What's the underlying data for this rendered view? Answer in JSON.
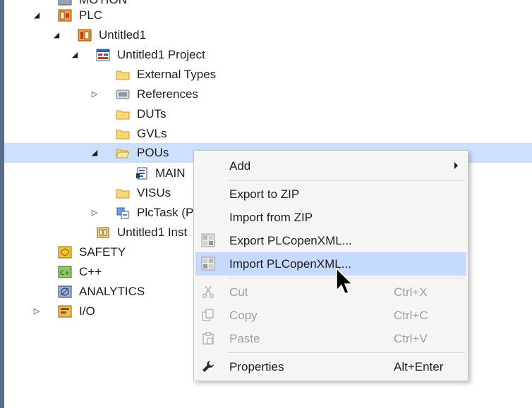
{
  "tree": {
    "motion_label": "MOTION",
    "plc_label": "PLC",
    "untitled1_label": "Untitled1",
    "project_label": "Untitled1 Project",
    "external_types_label": "External Types",
    "references_label": "References",
    "duts_label": "DUTs",
    "gvls_label": "GVLs",
    "pous_label": "POUs",
    "main_label": "MAIN",
    "visus_label": "VISUs",
    "plctask_label": "PlcTask (Pl",
    "instance_label": "Untitled1 Inst",
    "safety_label": "SAFETY",
    "cpp_label": "C++",
    "analytics_label": "ANALYTICS",
    "io_label": "I/O"
  },
  "context_menu": {
    "add": "Add",
    "export_zip": "Export to ZIP",
    "import_zip": "Import from ZIP",
    "export_plcopen": "Export PLCopenXML...",
    "import_plcopen": "Import PLCopenXML...",
    "cut": "Cut",
    "cut_shortcut": "Ctrl+X",
    "copy": "Copy",
    "copy_shortcut": "Ctrl+C",
    "paste": "Paste",
    "paste_shortcut": "Ctrl+V",
    "properties": "Properties",
    "properties_shortcut": "Alt+Enter"
  },
  "colors": {
    "selection": "#cce0ff",
    "menu_highlight": "#c6d9ff",
    "menu_background": "#f5f5f5",
    "disabled_text": "#a0a0a0"
  }
}
